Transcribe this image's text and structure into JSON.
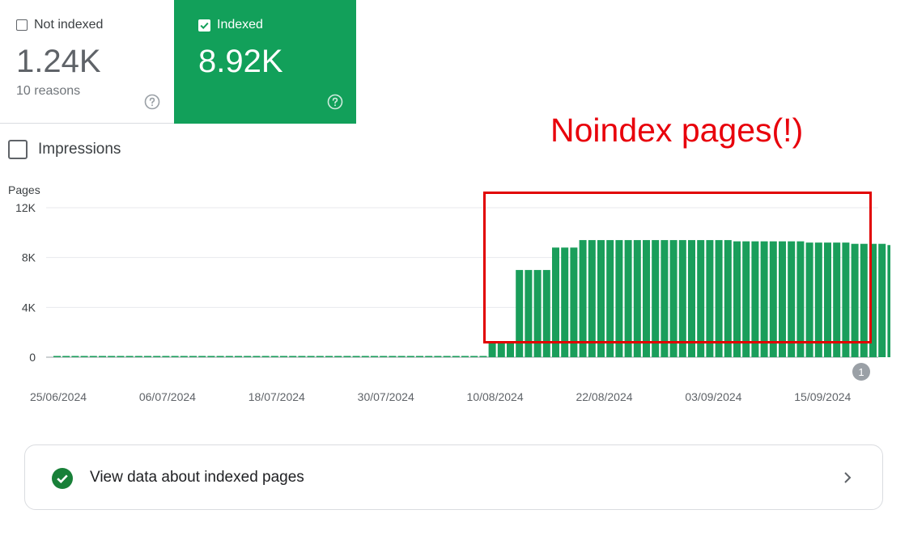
{
  "cards": {
    "not_indexed": {
      "label": "Not indexed",
      "value": "1.24K",
      "sub": "10 reasons",
      "checked": false
    },
    "indexed": {
      "label": "Indexed",
      "value": "8.92K",
      "checked": true
    }
  },
  "impressions": {
    "label": "Impressions",
    "checked": false
  },
  "annotation": {
    "text": "Noindex pages(!)"
  },
  "link": {
    "label": "View data about indexed pages"
  },
  "colors": {
    "indexed_green": "#12a05a",
    "bar_green": "#1a9e5b",
    "annotation_red": "#e8000b"
  },
  "chart_data": {
    "type": "bar",
    "ylabel": "Pages",
    "ylim": [
      0,
      12000
    ],
    "yticks": [
      0,
      4000,
      8000,
      12000
    ],
    "ytick_labels": [
      "0",
      "4K",
      "8K",
      "12K"
    ],
    "xtick_labels": [
      "25/06/2024",
      "06/07/2024",
      "18/07/2024",
      "30/07/2024",
      "10/08/2024",
      "22/08/2024",
      "03/09/2024",
      "15/09/2024"
    ],
    "annotation_marker": "1",
    "grid": true,
    "series": [
      {
        "values": [
          100,
          100,
          100,
          100,
          100,
          100,
          100,
          100,
          100,
          100,
          100,
          100,
          100,
          100,
          100,
          100,
          100,
          100,
          100,
          100,
          100,
          100,
          100,
          100,
          100,
          100,
          100,
          100,
          100,
          100,
          100,
          100,
          100,
          100,
          100,
          100,
          100,
          100,
          100,
          100,
          100,
          100,
          100,
          100,
          100,
          100,
          100,
          100,
          1200,
          1200,
          1200,
          7000,
          7000,
          7000,
          7000,
          8800,
          8800,
          8800,
          9400,
          9400,
          9400,
          9400,
          9400,
          9400,
          9400,
          9400,
          9400,
          9400,
          9400,
          9400,
          9400,
          9400,
          9400,
          9400,
          9400,
          9300,
          9300,
          9300,
          9300,
          9300,
          9300,
          9300,
          9300,
          9200,
          9200,
          9200,
          9200,
          9200,
          9100,
          9100,
          9100,
          9100,
          9000,
          9000,
          9000,
          8900,
          8900,
          8900,
          8900
        ]
      }
    ]
  }
}
